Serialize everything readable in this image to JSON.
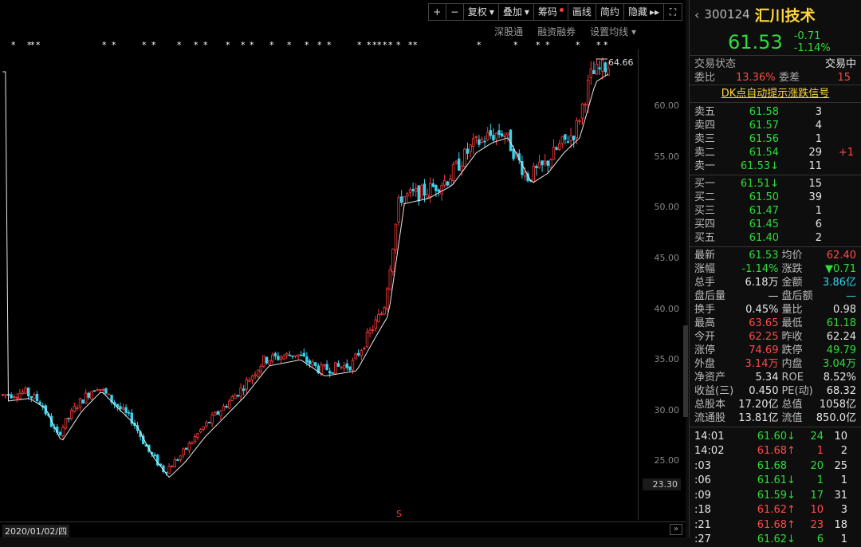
{
  "toolbar": {
    "plus": "+",
    "minus": "−",
    "fq": "复权",
    "dj": "叠加",
    "cm": "筹码",
    "hx": "画线",
    "jy": "简约",
    "yc": "隐藏",
    "more": "▸▸"
  },
  "subbar": {
    "sgt": "深股通",
    "rzrq": "融资融券",
    "sz": "设置均线"
  },
  "chart": {
    "max_label": "64.66",
    "low_label": "23.30",
    "date": "2020/01/02/四",
    "mark": "S",
    "y_ticks": [
      "60.00",
      "55.00",
      "50.00",
      "45.00",
      "40.00",
      "35.00",
      "30.00",
      "25.00"
    ]
  },
  "chart_data": {
    "type": "candlestick",
    "y_min": 23.3,
    "y_max": 64.66,
    "last": 61.53,
    "trend": [
      [
        0,
        31.5
      ],
      [
        30,
        31.8
      ],
      [
        50,
        30.8
      ],
      [
        70,
        27.5
      ],
      [
        95,
        30.5
      ],
      [
        120,
        32.5
      ],
      [
        145,
        30.5
      ],
      [
        165,
        29
      ],
      [
        185,
        26
      ],
      [
        205,
        24
      ],
      [
        225,
        25.5
      ],
      [
        250,
        28
      ],
      [
        275,
        30
      ],
      [
        300,
        32
      ],
      [
        330,
        35
      ],
      [
        370,
        35.6
      ],
      [
        400,
        34
      ],
      [
        440,
        34.5
      ],
      [
        465,
        38
      ],
      [
        480,
        40
      ],
      [
        500,
        51
      ],
      [
        530,
        51.5
      ],
      [
        560,
        52.8
      ],
      [
        590,
        56
      ],
      [
        610,
        57
      ],
      [
        630,
        57.5
      ],
      [
        660,
        53
      ],
      [
        680,
        54
      ],
      [
        700,
        56
      ],
      [
        720,
        57.5
      ],
      [
        740,
        63
      ],
      [
        760,
        64
      ]
    ]
  },
  "stock": {
    "code": "300124",
    "name": "汇川技术",
    "price": "61.53",
    "change": "-0.71",
    "pct": "-1.14%"
  },
  "status": {
    "label": "交易状态",
    "value": "交易中",
    "wb_label": "委比",
    "wb": "13.36%",
    "wc_label": "委差",
    "wc": "15",
    "dk": "DK点自动提示涨跌信号"
  },
  "sells": [
    {
      "label": "卖五",
      "price": "61.58",
      "vol": "3",
      "chg": ""
    },
    {
      "label": "卖四",
      "price": "61.57",
      "vol": "4",
      "chg": ""
    },
    {
      "label": "卖三",
      "price": "61.56",
      "vol": "1",
      "chg": ""
    },
    {
      "label": "卖二",
      "price": "61.54",
      "vol": "29",
      "chg": "+1"
    },
    {
      "label": "卖一",
      "price": "61.53↓",
      "vol": "11",
      "chg": ""
    }
  ],
  "buys": [
    {
      "label": "买一",
      "price": "61.51↓",
      "vol": "15"
    },
    {
      "label": "买二",
      "price": "61.50",
      "vol": "39"
    },
    {
      "label": "买三",
      "price": "61.47",
      "vol": "1"
    },
    {
      "label": "买四",
      "price": "61.45",
      "vol": "6"
    },
    {
      "label": "买五",
      "price": "61.40",
      "vol": "2"
    }
  ],
  "stats": [
    {
      "l": "最新",
      "v": "61.53",
      "vc": "green",
      "l2": "均价",
      "v2": "62.40",
      "v2c": "red"
    },
    {
      "l": "涨幅",
      "v": "-1.14%",
      "vc": "green",
      "l2": "涨跌",
      "v2": "▼0.71",
      "v2c": "green"
    },
    {
      "l": "总手",
      "v": "6.18万",
      "vc": "white",
      "l2": "金额",
      "v2": "3.86亿",
      "v2c": "cyan"
    },
    {
      "l": "盘后量",
      "v": "—",
      "vc": "white",
      "l2": "盘后额",
      "v2": "—",
      "v2c": "cyan"
    },
    {
      "l": "换手",
      "v": "0.45%",
      "vc": "white",
      "l2": "量比",
      "v2": "0.98",
      "v2c": "white"
    },
    {
      "l": "最高",
      "v": "63.65",
      "vc": "red",
      "l2": "最低",
      "v2": "61.18",
      "v2c": "green"
    },
    {
      "l": "今开",
      "v": "62.25",
      "vc": "red",
      "l2": "昨收",
      "v2": "62.24",
      "v2c": "white"
    },
    {
      "l": "涨停",
      "v": "74.69",
      "vc": "red",
      "l2": "跌停",
      "v2": "49.79",
      "v2c": "green"
    },
    {
      "l": "外盘",
      "v": "3.14万",
      "vc": "red",
      "l2": "内盘",
      "v2": "3.04万",
      "v2c": "green"
    },
    {
      "l": "净资产",
      "v": "5.34",
      "vc": "white",
      "l2": "ROE",
      "v2": "8.52%",
      "v2c": "white"
    },
    {
      "l": "收益(三)",
      "v": "0.450",
      "vc": "white",
      "l2": "PE(动)",
      "v2": "68.32",
      "v2c": "white"
    },
    {
      "l": "总股本",
      "v": "17.20亿",
      "vc": "white",
      "l2": "总值",
      "v2": "1058亿",
      "v2c": "white"
    },
    {
      "l": "流通股",
      "v": "13.81亿",
      "vc": "white",
      "l2": "流值",
      "v2": "850.0亿",
      "v2c": "white"
    }
  ],
  "ticks": [
    {
      "t": "14:01",
      "p": "61.60",
      "a": "↓",
      "c": "green",
      "v": "24",
      "n": "10"
    },
    {
      "t": "14:02",
      "p": "61.68",
      "a": "↑",
      "c": "red",
      "v": "1",
      "n": "2"
    },
    {
      "t": ":03",
      "p": "61.68",
      "a": "",
      "c": "green",
      "v": "20",
      "n": "25"
    },
    {
      "t": ":06",
      "p": "61.61",
      "a": "↓",
      "c": "green",
      "v": "1",
      "n": "1"
    },
    {
      "t": ":09",
      "p": "61.59",
      "a": "↓",
      "c": "green",
      "v": "17",
      "n": "31"
    },
    {
      "t": ":18",
      "p": "61.62",
      "a": "↑",
      "c": "red",
      "v": "10",
      "n": "3"
    },
    {
      "t": ":21",
      "p": "61.68",
      "a": "↑",
      "c": "red",
      "v": "23",
      "n": "18"
    },
    {
      "t": ":27",
      "p": "61.62",
      "a": "↓",
      "c": "green",
      "v": "6",
      "n": "1"
    }
  ]
}
